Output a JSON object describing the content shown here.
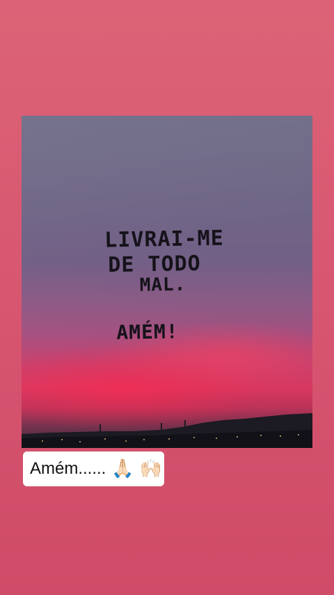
{
  "story": {
    "background_color": "#d95b73",
    "photo": {
      "text_lines": [
        "LIVRAI-ME",
        "DE TODO",
        "MAL.",
        "AMÉM!"
      ]
    },
    "caption": {
      "text": "Amém......",
      "emoji_1": "🙏🏻",
      "emoji_2": "🙌🏻"
    }
  }
}
